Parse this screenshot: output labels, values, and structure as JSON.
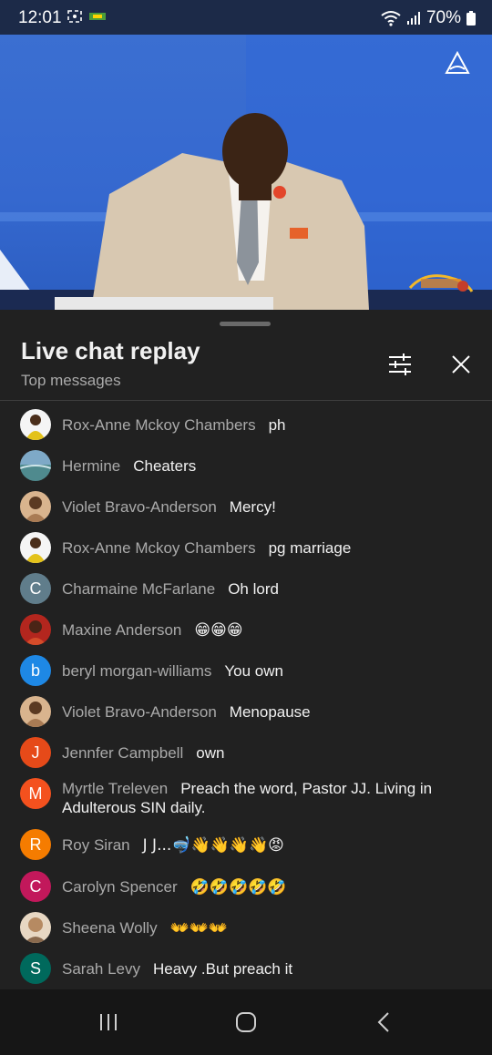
{
  "status_bar": {
    "time": "12:01",
    "battery": "70%"
  },
  "panel": {
    "title": "Live chat replay",
    "subtitle": "Top messages"
  },
  "colors": {
    "avatar_c": "#607d8b",
    "avatar_b": "#1e88e5",
    "avatar_j": "#e64a19",
    "avatar_m": "#f4511e",
    "avatar_r": "#f57c00",
    "avatar_c2": "#c2185b",
    "avatar_s": "#00695c"
  },
  "messages": [
    {
      "author": "Rox-Anne Mckoy Chambers",
      "text": "ph",
      "avatar": "photo-yellow"
    },
    {
      "author": "Hermine",
      "text": "Cheaters",
      "avatar": "photo-sea"
    },
    {
      "author": "Violet Bravo-Anderson",
      "text": "Mercy!",
      "avatar": "photo-violet"
    },
    {
      "author": "Rox-Anne Mckoy Chambers",
      "text": "pg marriage",
      "avatar": "photo-yellow"
    },
    {
      "author": "Charmaine McFarlane",
      "text": "Oh lord",
      "avatar_letter": "C"
    },
    {
      "author": "Maxine Anderson",
      "text": "😁😁😁",
      "avatar": "photo-red"
    },
    {
      "author": "beryl morgan-williams",
      "text": "You own",
      "avatar_letter": "b"
    },
    {
      "author": "Violet Bravo-Anderson",
      "text": "Menopause",
      "avatar": "photo-violet"
    },
    {
      "author": "Jennfer Campbell",
      "text": "own",
      "avatar_letter": "J"
    },
    {
      "author": "Myrtle Treleven",
      "text": "Preach the word, Pastor JJ. Living in Adulterous SIN daily.",
      "avatar_letter": "M"
    },
    {
      "author": "Roy Siran",
      "text": "J J...🤿👋👋👋👋😡",
      "avatar_letter": "R"
    },
    {
      "author": "Carolyn Spencer",
      "text": "🤣🤣🤣🤣🤣",
      "avatar_letter": "C"
    },
    {
      "author": "Sheena Wolly",
      "text": "👐👐👐",
      "avatar": "photo-sheena"
    },
    {
      "author": "Sarah Levy",
      "text": "Heavy .But preach it",
      "avatar_letter": "S"
    }
  ]
}
